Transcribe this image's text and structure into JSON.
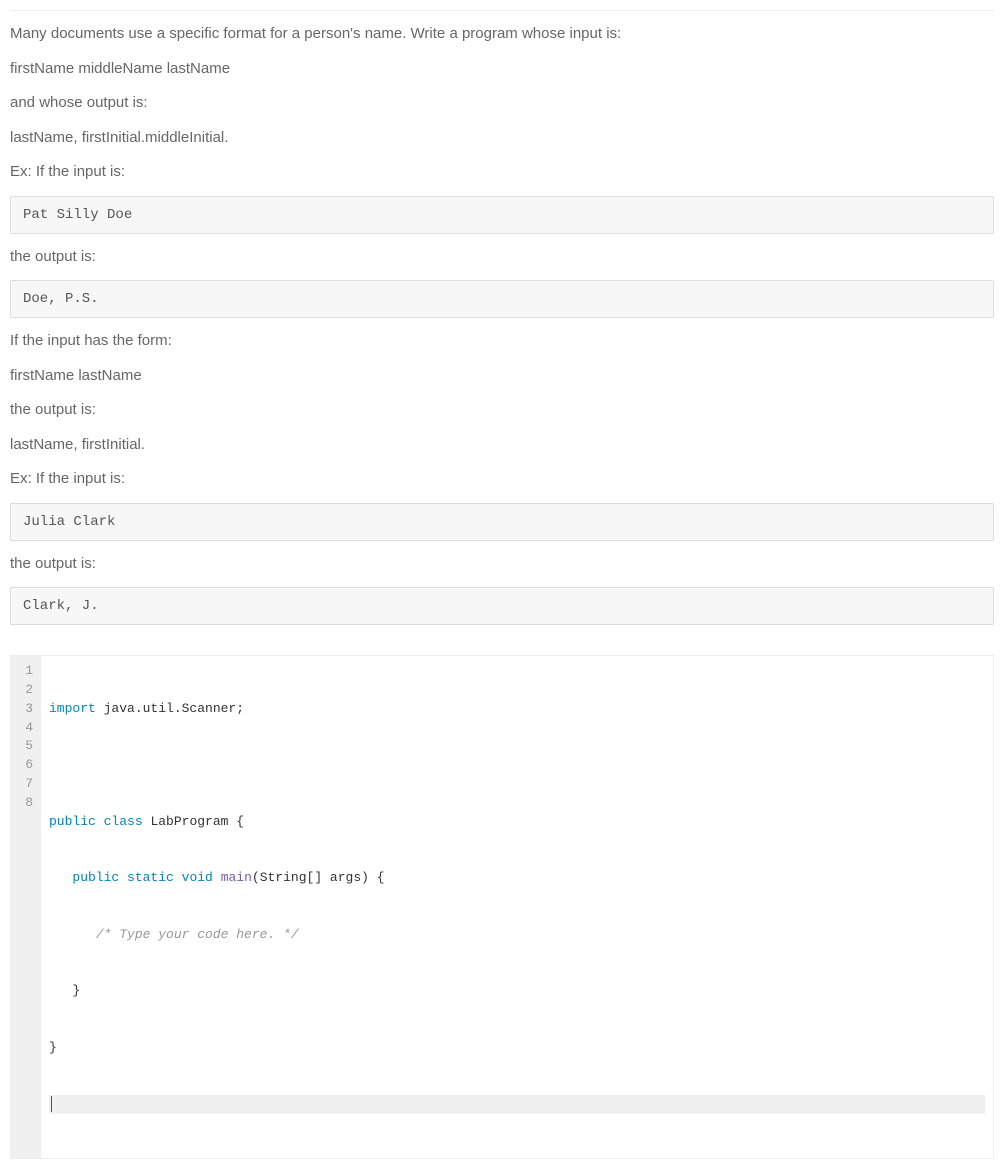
{
  "problem": {
    "p1": "Many documents use a specific format for a person's name. Write a program whose input is:",
    "p2": "firstName middleName lastName",
    "p3": "and whose output is:",
    "p4": "lastName, firstInitial.middleInitial.",
    "p5": "Ex: If the input is:",
    "example1_input": "Pat Silly Doe",
    "p6": "the output is:",
    "example1_output": "Doe, P.S.",
    "p7": "If the input has the form:",
    "p8": "firstName lastName",
    "p9": "the output is:",
    "p10": "lastName, firstInitial.",
    "p11": "Ex: If the input is:",
    "example2_input": "Julia Clark",
    "p12": "the output is:",
    "example2_output": "Clark, J."
  },
  "code": {
    "line_numbers": [
      "1",
      "2",
      "3",
      "4",
      "5",
      "6",
      "7",
      "8"
    ],
    "l1_kw": "import",
    "l1_rest": " java.util.Scanner;",
    "l2": "",
    "l3_kw1": "public",
    "l3_kw2": "class",
    "l3_rest": " LabProgram {",
    "l4_indent": "   ",
    "l4_kw1": "public",
    "l4_kw2": "static",
    "l4_kw3": "void",
    "l4_method": "main",
    "l4_rest": "(String[] args) {",
    "l5_indent": "      ",
    "l5_comment": "/* Type your code here. */",
    "l6": "   }",
    "l7": "}",
    "l8": ""
  }
}
